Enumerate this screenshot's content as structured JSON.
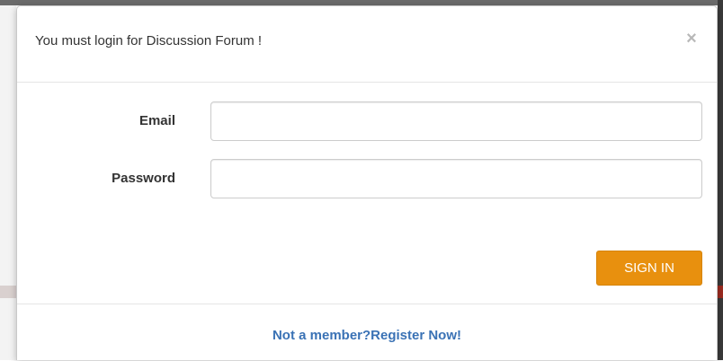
{
  "modal": {
    "title": "You must login for Discussion Forum !",
    "close_symbol": "×",
    "close_icon": "close-icon"
  },
  "form": {
    "email_label": "Email",
    "email_value": "",
    "email_placeholder": "",
    "password_label": "Password",
    "password_value": "",
    "password_placeholder": "",
    "submit_label": "SIGN IN"
  },
  "footer": {
    "register_text": "Not a member?Register Now!"
  },
  "colors": {
    "accent": "#e8900e",
    "link": "#3a72b5",
    "text": "#333333"
  }
}
